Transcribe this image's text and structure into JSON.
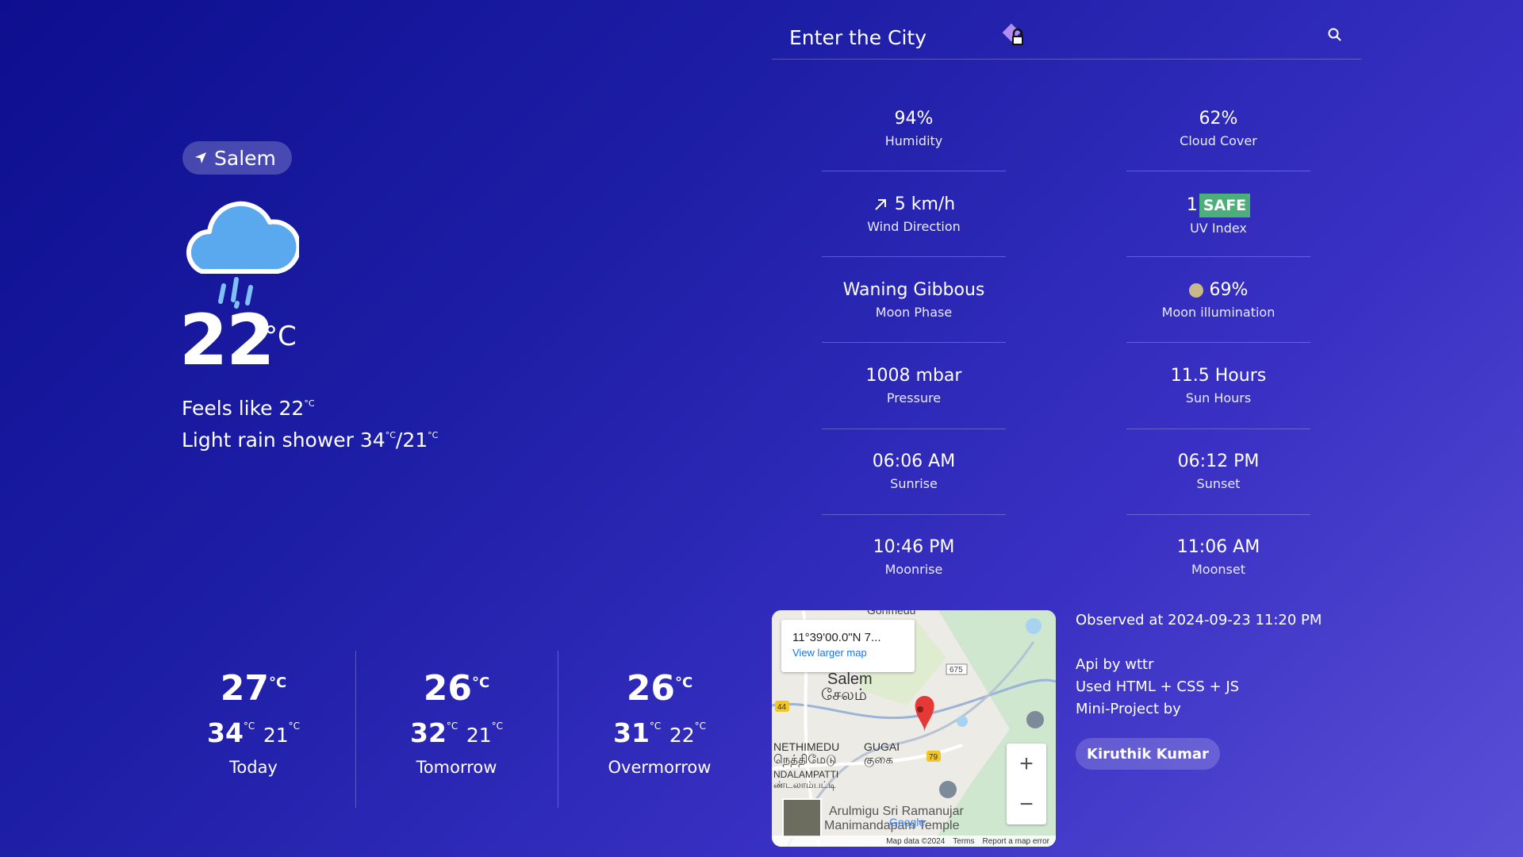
{
  "search": {
    "placeholder": "Enter the City"
  },
  "current": {
    "location": "Salem",
    "temp": "22",
    "unit": "°C",
    "feels_like_label": "Feels like",
    "feels_like": "22",
    "description": "Light rain shower",
    "high": "34",
    "low": "21"
  },
  "stats": [
    {
      "value": "94%",
      "label": "Humidity"
    },
    {
      "value": "62%",
      "label": "Cloud Cover"
    },
    {
      "value": "5 km/h",
      "label": "Wind Direction",
      "icon": "arrow-up-right-icon"
    },
    {
      "value": "1",
      "badge": "SAFE",
      "label": "UV Index"
    },
    {
      "value": "Waning Gibbous",
      "label": "Moon Phase"
    },
    {
      "value": "69%",
      "label": "Moon illumination",
      "icon": "moon-icon"
    },
    {
      "value": "1008 mbar",
      "label": "Pressure"
    },
    {
      "value": "11.5 Hours",
      "label": "Sun Hours"
    },
    {
      "value": "06:06 AM",
      "label": "Sunrise"
    },
    {
      "value": "06:12 PM",
      "label": "Sunset"
    },
    {
      "value": "10:46 PM",
      "label": "Moonrise"
    },
    {
      "value": "11:06 AM",
      "label": "Moonset"
    }
  ],
  "forecast": [
    {
      "avg": "27",
      "high": "34",
      "low": "21",
      "day": "Today"
    },
    {
      "avg": "26",
      "high": "32",
      "low": "21",
      "day": "Tomorrow"
    },
    {
      "avg": "26",
      "high": "31",
      "low": "22",
      "day": "Overmorrow"
    }
  ],
  "map": {
    "coord": "11°39'00.0\"N 7...",
    "view_larger": "View larger map",
    "label_salem": "Salem",
    "label_salem_ta": "சேலம்",
    "label_nethimedu": "NETHIMEDU",
    "label_nethimedu_ta": "நெத்திமேடு",
    "label_gugai": "GUGAI",
    "label_gugai_ta": "குகை",
    "label_ndalampatti": "NDALAMPATTI",
    "label_ndalampatti_ta": "ண்டலாம்பட்டி",
    "label_gorimedu": "Gorimedu",
    "label_temple1": "Arulmigu Sri Ramanujar",
    "label_temple2": "Manimandapam Temple",
    "road_44": "44",
    "road_79": "79",
    "road_675": "675",
    "map_data": "Map data ©2024",
    "terms": "Terms",
    "report": "Report a map error",
    "zoom_in": "+",
    "zoom_out": "−",
    "google": "Google"
  },
  "info": {
    "observed": "Observed at 2024-09-23 11:20 PM",
    "api": "Api by wttr",
    "used": "Used HTML + CSS + JS",
    "mini": "Mini-Project by",
    "author": "Kiruthik Kumar"
  }
}
